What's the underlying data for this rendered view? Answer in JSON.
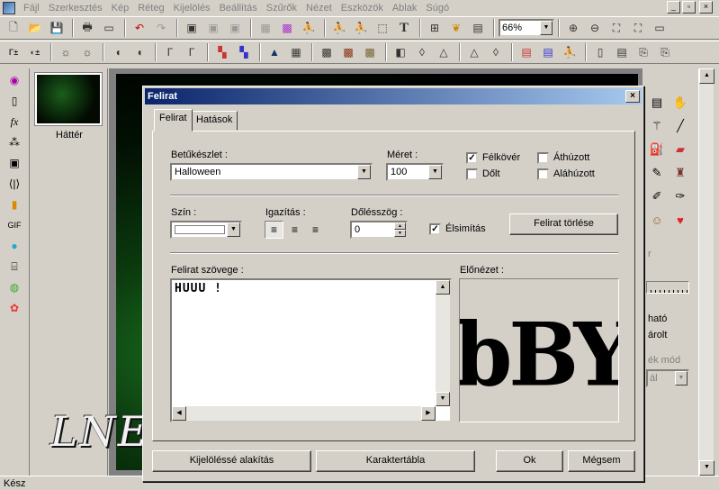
{
  "app": {
    "menu": [
      "Fájl",
      "Szerkesztés",
      "Kép",
      "Réteg",
      "Kijelölés",
      "Beállítás",
      "Szűrők",
      "Nézet",
      "Eszközök",
      "Ablak",
      "Súgó"
    ],
    "window_controls": [
      "_",
      "▫",
      "×"
    ],
    "zoom_value": "66%",
    "toolbar1_icons": [
      "new-icon",
      "open-icon",
      "save-icon",
      "print-icon",
      "scan-icon",
      "undo-icon",
      "redo-icon",
      "image-icon",
      "image2-icon",
      "image3-icon",
      "grid-icon",
      "mosaic-icon",
      "figure-icon",
      "run-icon",
      "figure2-icon",
      "select-icon",
      "text-icon",
      "tree-icon",
      "leaf-icon",
      "window-icon",
      "zoom-in-icon",
      "zoom-out-icon",
      "fit-icon",
      "full-icon",
      "screen-icon"
    ],
    "toolbar2_icons": [
      "auto-levels-icon",
      "auto-contrast-icon",
      "brightness-icon",
      "brightness-plus-icon",
      "contrast-icon",
      "contrast-plus-icon",
      "gamma-icon",
      "gamma-plus-icon",
      "color-icon",
      "color-plus-icon",
      "mountain-icon",
      "histogram-icon",
      "pixel-icon",
      "pixel2-icon",
      "pixel3-icon",
      "mask-icon",
      "drop-icon",
      "drop2-icon",
      "triangle-icon",
      "drop3-icon",
      "palette-icon",
      "palette2-icon",
      "walk-icon",
      "book-icon",
      "page-icon",
      "export-icon",
      "export2-icon"
    ],
    "layer_name": "Háttér",
    "right_panel_texts": [
      "ható",
      "árolt",
      "ék mód",
      "ál"
    ],
    "status": "Kész",
    "watermark": "LNE"
  },
  "dialog": {
    "title": "Felirat",
    "close": "×",
    "tabs": [
      "Felirat",
      "Hatások"
    ],
    "font_label": "Betűkészlet :",
    "font_value": "Halloween",
    "size_label": "Méret :",
    "size_value": "100",
    "bold_label": "Félkövér",
    "bold_checked": true,
    "italic_label": "Dőlt",
    "italic_checked": false,
    "strike_label": "Áthúzott",
    "strike_checked": false,
    "underline_label": "Aláhúzott",
    "underline_checked": false,
    "color_label": "Szín :",
    "color_value": "#ffffff",
    "align_label": "Igazítás :",
    "align_options": [
      "left",
      "center",
      "right"
    ],
    "align_selected": "left",
    "angle_label": "Dőlésszög :",
    "angle_value": "0",
    "antialias_label": "Élsimítás",
    "antialias_checked": true,
    "clear_button": "Felirat törlése",
    "text_label": "Felirat szövege :",
    "text_value": "HUUU !",
    "preview_label": "Előnézet :",
    "preview_text": "bBY",
    "buttons": {
      "to_selection": "Kijelöléssé alakítás",
      "charmap": "Karaktertábla",
      "ok": "Ok",
      "cancel": "Mégsem"
    }
  }
}
